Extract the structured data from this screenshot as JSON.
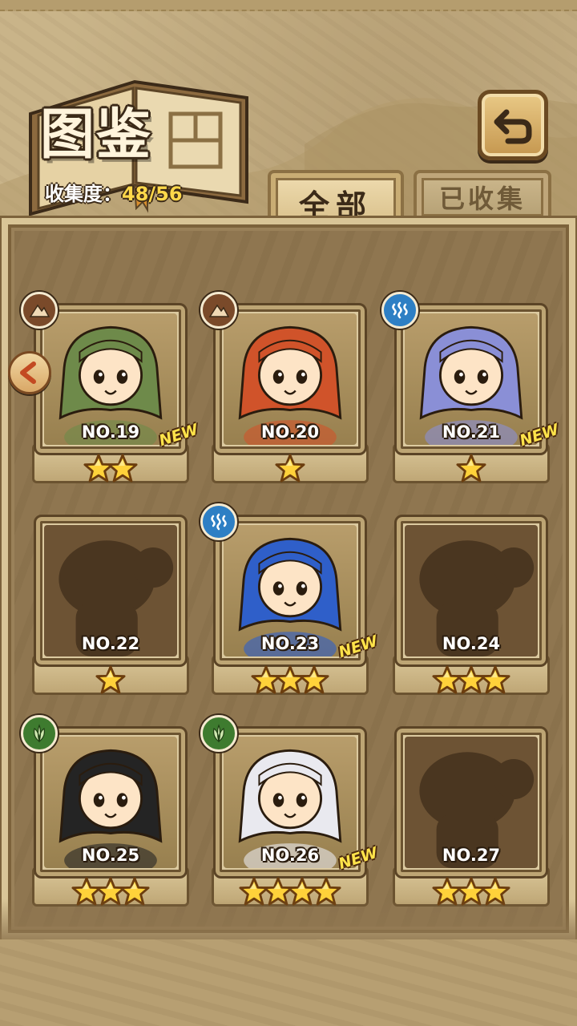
{
  "header": {
    "title": "图鉴",
    "collection_label": "收集度：",
    "collection_value": "48/56"
  },
  "tabs": [
    {
      "label": "全部",
      "active": true
    },
    {
      "label": "已收集",
      "active": false
    }
  ],
  "cards": [
    {
      "number": "NO.19",
      "stars": 2,
      "element": "earth-icon",
      "is_new": true,
      "locked": false,
      "char_color": "#6e8a4a"
    },
    {
      "number": "NO.20",
      "stars": 1,
      "element": "earth-icon",
      "is_new": false,
      "locked": false,
      "char_color": "#d0532a"
    },
    {
      "number": "NO.21",
      "stars": 1,
      "element": "water-icon",
      "is_new": true,
      "locked": false,
      "char_color": "#8a8fd6"
    },
    {
      "number": "NO.22",
      "stars": 1,
      "element": "",
      "is_new": false,
      "locked": true,
      "char_color": "#4a3620"
    },
    {
      "number": "NO.23",
      "stars": 3,
      "element": "water-icon",
      "is_new": true,
      "locked": false,
      "char_color": "#2f5fc9"
    },
    {
      "number": "NO.24",
      "stars": 3,
      "element": "",
      "is_new": false,
      "locked": true,
      "char_color": "#4a3620"
    },
    {
      "number": "NO.25",
      "stars": 3,
      "element": "grass-icon",
      "is_new": false,
      "locked": false,
      "char_color": "#242424"
    },
    {
      "number": "NO.26",
      "stars": 4,
      "element": "grass-icon",
      "is_new": true,
      "locked": false,
      "char_color": "#e9e9ef"
    },
    {
      "number": "NO.27",
      "stars": 3,
      "element": "",
      "is_new": false,
      "locked": true,
      "char_color": "#4a3620"
    }
  ],
  "new_badge_text": "NEW",
  "colors": {
    "accent_gold": "#ffd84a",
    "earth": "#7a4a2a",
    "water": "#2e7fc4",
    "grass": "#3e7b2f"
  }
}
